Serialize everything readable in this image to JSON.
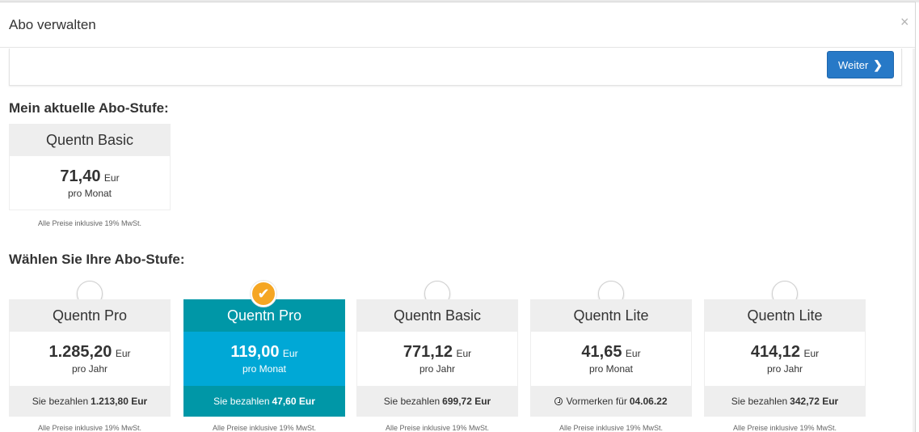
{
  "modal": {
    "title": "Abo verwalten",
    "close_label": "×",
    "weiter_label": "Weiter",
    "weiter_icon": "chevron-right-icon"
  },
  "current": {
    "section_title": "Mein aktuelle Abo-Stufe:",
    "card": {
      "name": "Quentn Basic",
      "price": "71,40",
      "currency": "Eur",
      "period": "pro Monat"
    },
    "note": "Alle Preise inklusive 19% MwSt."
  },
  "choose": {
    "section_title": "Wählen Sie Ihre Abo-Stufe:",
    "cards": [
      {
        "name": "Quentn Pro",
        "price": "1.285,20",
        "currency": "Eur",
        "period": "pro Jahr",
        "footer_prefix": "Sie bezahlen",
        "footer_value": "1.213,80 Eur",
        "selected": false,
        "note": "Alle Preise inklusive 19% MwSt."
      },
      {
        "name": "Quentn Pro",
        "price": "119,00",
        "currency": "Eur",
        "period": "pro Monat",
        "footer_prefix": "Sie bezahlen",
        "footer_value": "47,60 Eur",
        "selected": true,
        "note": "Alle Preise inklusive 19% MwSt."
      },
      {
        "name": "Quentn Basic",
        "price": "771,12",
        "currency": "Eur",
        "period": "pro Jahr",
        "footer_prefix": "Sie bezahlen",
        "footer_value": "699,72 Eur",
        "selected": false,
        "note": "Alle Preise inklusive 19% MwSt."
      },
      {
        "name": "Quentn Lite",
        "price": "41,65",
        "currency": "Eur",
        "period": "pro Monat",
        "footer_prefix": "Vormerken für",
        "footer_value": "04.06.22",
        "footer_icon": "clock-icon",
        "selected": false,
        "note": "Alle Preise inklusive 19% MwSt."
      },
      {
        "name": "Quentn Lite",
        "price": "414,12",
        "currency": "Eur",
        "period": "pro Jahr",
        "footer_prefix": "Sie bezahlen",
        "footer_value": "342,72 Eur",
        "selected": false,
        "note": "Alle Preise inklusive 19% MwSt."
      }
    ]
  },
  "colors": {
    "primary_button": "#2779c7",
    "selected_dark": "#0097a7",
    "selected_light": "#00a8d6",
    "check_orange": "#f5a623"
  }
}
